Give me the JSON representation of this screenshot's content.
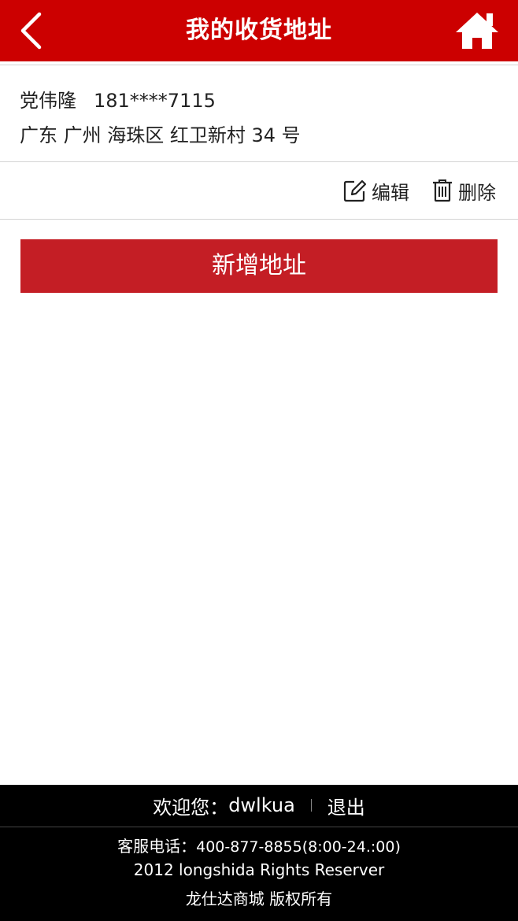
{
  "header": {
    "title": "我的收货地址"
  },
  "address": {
    "name": "党伟隆",
    "phone": "181****7115",
    "full_address": "广东 广州 海珠区 红卫新村 34 号"
  },
  "actions": {
    "edit_label": "编辑",
    "delete_label": "删除"
  },
  "add_button": {
    "label": "新增地址"
  },
  "footer": {
    "welcome_label": "欢迎您：",
    "username": "dwlkua",
    "logout_label": "退出",
    "service_label": "客服电话：",
    "service_phone": "400-877-8855(8:00-24.:00)",
    "rights": "2012 longshida Rights Reserver",
    "copyright": "龙仕达商城 版权所有"
  },
  "colors": {
    "header_bg": "#cc0000",
    "button_bg": "#c41e25",
    "footer_bg": "#000000"
  }
}
